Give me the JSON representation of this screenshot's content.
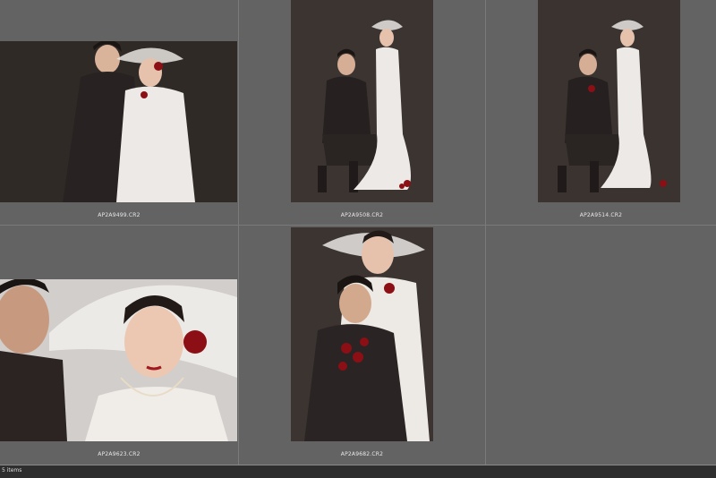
{
  "thumbnails": [
    {
      "filename": "AP2A9499.CR2"
    },
    {
      "filename": "AP2A9508.CR2"
    },
    {
      "filename": "AP2A9514.CR2"
    },
    {
      "filename": "AP2A9623.CR2"
    },
    {
      "filename": "AP2A9682.CR2"
    }
  ],
  "status_bar": {
    "item_count": "5 items"
  },
  "colors": {
    "background": "#5f5f5f",
    "backdrop": "#3a3330",
    "dress": "#e9e6e2",
    "suit": "#2a2626",
    "rose": "#8b0f14"
  }
}
